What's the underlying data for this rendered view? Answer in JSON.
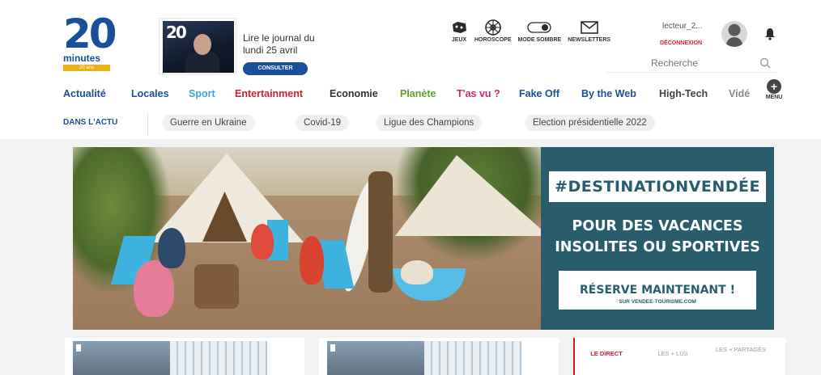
{
  "logo": {
    "number": "20",
    "word": "minutes",
    "badge": "20 ans"
  },
  "journal": {
    "line1": "Lire le journal du",
    "line2": "lundi 25 avril",
    "button": "CONSULTER",
    "thumb_text": "20"
  },
  "tools": [
    {
      "icon": "gamepad-icon",
      "label": "JEUX"
    },
    {
      "icon": "horoscope-wheel-icon",
      "label": "HOROSCOPE"
    },
    {
      "icon": "dark-mode-toggle-icon",
      "label": "MODE SOMBRE",
      "toggle_text": "NOIR"
    },
    {
      "icon": "envelope-icon",
      "label": "NEWSLETTERS"
    }
  ],
  "user": {
    "name": "lecteur_2...",
    "logout": "DÉCONNEXION"
  },
  "search": {
    "placeholder": "Recherche"
  },
  "nav": [
    {
      "label": "Actualité",
      "color": "#1a4f9c"
    },
    {
      "label": "Locales",
      "color": "#1a4f9c"
    },
    {
      "label": "Sport",
      "color": "#3ea4d8"
    },
    {
      "label": "Entertainment",
      "color": "#d21f2a"
    },
    {
      "label": "Economie",
      "color": "#333333"
    },
    {
      "label": "Planète",
      "color": "#5aa332"
    },
    {
      "label": "T'as vu ?",
      "color": "#d6226e"
    },
    {
      "label": "Fake Off",
      "color": "#1a4f9c"
    },
    {
      "label": "By the Web",
      "color": "#1a4f9c"
    },
    {
      "label": "High-Tech",
      "color": "#444444"
    },
    {
      "label": "Vidé",
      "color": "#888888"
    }
  ],
  "menu": {
    "label": "MENU",
    "glyph": "+"
  },
  "actu": {
    "label": "DANS L'ACTU",
    "pills": [
      "Guerre en Ukraine",
      "Covid-19",
      "Ligue des Champions",
      "Election présidentielle 2022"
    ]
  },
  "ad": {
    "hashtag": "#DESTINATIONVENDÉE",
    "claim1": "POUR DES VACANCES",
    "claim2": "INSOLITES OU SPORTIVES",
    "cta": "RÉSERVE MAINTENANT !",
    "cta_sub": "SUR VENDEE-TOURISME.COM"
  },
  "live_tabs": [
    {
      "label": "LE DIRECT",
      "active": true
    },
    {
      "label": "LES + LUS",
      "active": false
    },
    {
      "label": "LES + PARTAGÉS",
      "active": false
    }
  ],
  "colors": {
    "brand": "#1a4f9c",
    "accent": "#d21f2a",
    "ad_teal": "#2a5d6c"
  }
}
